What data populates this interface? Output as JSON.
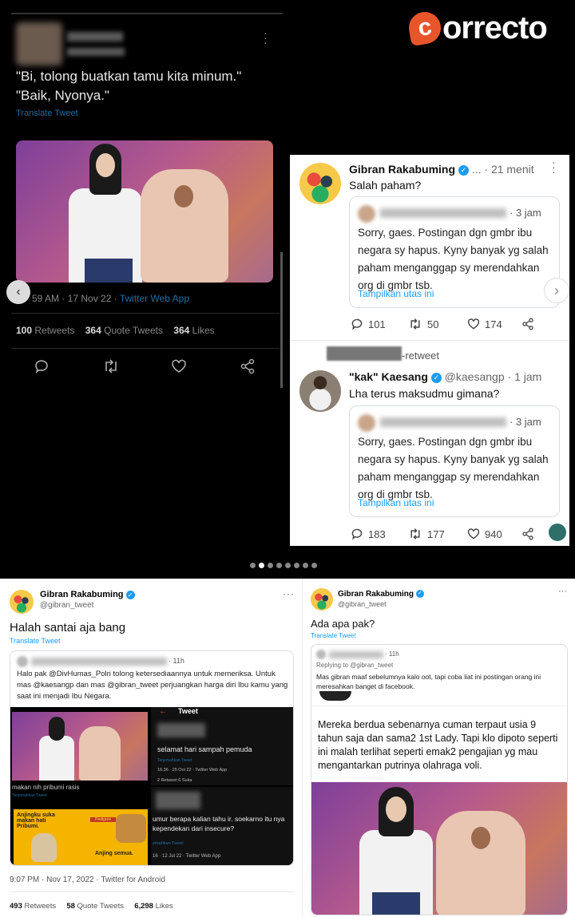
{
  "watermark": {
    "logo_text": "orrecto",
    "logo_letter": "c"
  },
  "tweet_dark": {
    "line1": "\"Bi, tolong buatkan tamu kita minum.\"",
    "line2": "\"Baik, Nyonya.\"",
    "translate": "Translate Tweet",
    "meta": "59 AM · 17 Nov 22 · ",
    "source": "Twitter Web App",
    "retweets_num": "100",
    "retweets_label": "Retweets",
    "quotes_num": "364",
    "quotes_label": "Quote Tweets",
    "likes_num": "364",
    "likes_label": "Likes"
  },
  "thread": {
    "post1": {
      "name": "Gibran Rakabuming",
      "time": "21 menit",
      "text": "Salah paham?"
    },
    "quote1": {
      "time": "3 jam",
      "text": "Sorry, gaes. Postingan dgn gmbr ibu negara sy hapus. Kyny banyak yg salah paham menganggap sy merendahkan org di gmbr tsb.",
      "link": "Tampilkan utas ini"
    },
    "actions1": {
      "replies": "101",
      "retweets": "50",
      "likes": "174"
    },
    "retweet_label": "-retweet",
    "post2": {
      "name": "\"kak\" Kaesang",
      "handle": "@kaesangp",
      "time": "1 jam",
      "text": "Lha terus maksudmu gimana?"
    },
    "quote2": {
      "time": "3 jam",
      "text": "Sorry, gaes. Postingan dgn gmbr ibu negara sy hapus. Kyny banyak yg salah paham menganggap sy merendahkan org di gmbr tsb.",
      "link": "Tampilkan utas ini"
    },
    "actions2": {
      "replies": "183",
      "retweets": "177",
      "likes": "940"
    }
  },
  "carousel": {
    "dots": 8,
    "active": 1
  },
  "left_tweet": {
    "name": "Gibran Rakabuming",
    "handle": "@gibran_tweet",
    "text": "Halah santai aja bang",
    "translate": "Translate Tweet",
    "quote_time": "11h",
    "quote_text": "Halo pak @DivHumas_Polri tolong ketersediaannya untuk memeriksa. Untuk mas @kaesangp dan mas @gibran_tweet perjuangkan harga diri Ibu kamu yang saat ini menjadi Ibu Negara.",
    "grid": {
      "tweet_header": "Tweet",
      "t1": "selamat hari sampah pemuda",
      "t1_meta": "16.36 · 25 Oct 22 · Twitter Web App",
      "t1_sub": "Terjemahkan Tweet",
      "t1_stats": "2 Retweet   6 Suka",
      "t2_pre": "makan nih pribumi rasis",
      "t2_sub": "Terjemahkan Tweet",
      "dog1": "Anjingku suka makan hati Pribumi.",
      "dog2": "Anjing semua.",
      "brand": "Pedigree",
      "t3": "umur berapa kalian tahu ir. soekarno itu nya kependekan dari insecure?",
      "t3_sub": "emahkan Tweet",
      "t3_meta": "16 · 12 Jul 22 · Twitter Web App"
    },
    "meta": "9:07 PM · Nov 17, 2022 · Twitter for Android",
    "retweets_num": "493",
    "retweets_label": "Retweets",
    "quotes_num": "58",
    "quotes_label": "Quote Tweets",
    "likes_num": "6,298",
    "likes_label": "Likes"
  },
  "right_tweet": {
    "name": "Gibran Rakabuming",
    "handle": "@gibran_tweet",
    "text": "Ada apa pak?",
    "translate": "Translate Tweet",
    "quote_time": "11h",
    "replying": "Replying to @gibran_tweet",
    "quote_text": "Mas gibran maaf sebelumnya kalo oot, tapi coba liat ini postingan orang ini meresahkan banget di facebook.",
    "fb_text": "Mereka berdua sebenarnya cuman terpaut usia 9 tahun saja dan sama2 1st Lady. Tapi klo dipoto seperti ini malah terlihat seperti emak2 pengajian yg mau mengantarkan putrinya olahraga voli."
  },
  "colors": {
    "accent": "#1d9bf0",
    "link_dark": "#1d6fa5",
    "bg_dark": "#000000",
    "brand_orange": "#e8552a"
  }
}
